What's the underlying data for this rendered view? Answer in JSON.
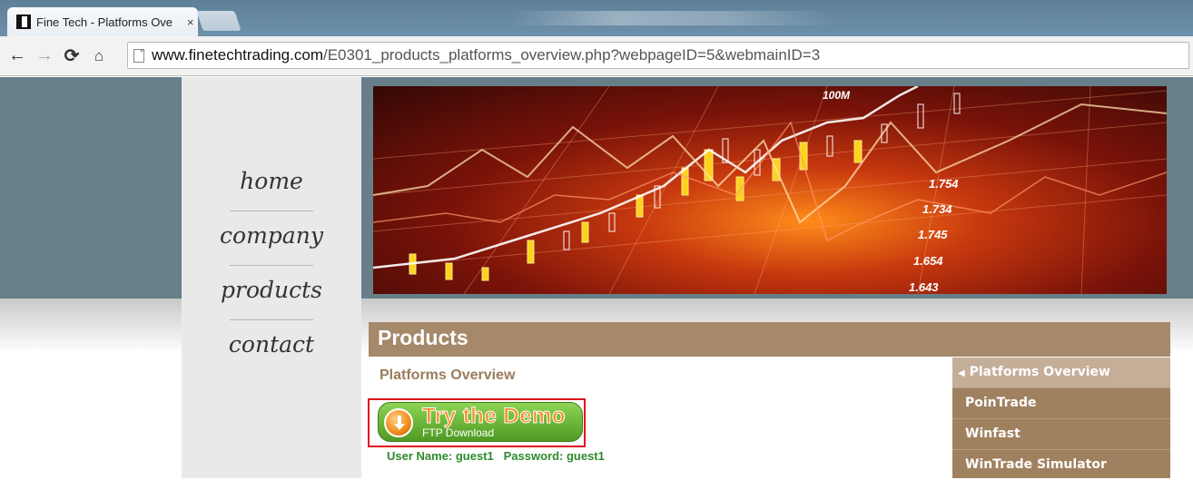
{
  "browser": {
    "tab_title": "Fine Tech - Platforms Ove",
    "tab_close": "×",
    "url_host": "www.finetechtrading.com",
    "url_path": "/E0301_products_platforms_overview.php?webpageID=5&webmainID=3",
    "icons": [
      "back-icon",
      "forward-icon",
      "reload-icon",
      "home-icon",
      "page-icon"
    ]
  },
  "nav": {
    "items": [
      {
        "label": "home"
      },
      {
        "label": "company"
      },
      {
        "label": "products"
      },
      {
        "label": "contact"
      }
    ]
  },
  "banner": {
    "labels": [
      "100M",
      "1.754",
      "1.734",
      "1.745",
      "1.654",
      "1.643"
    ]
  },
  "products": {
    "title": "Products",
    "section_title": "Platforms Overview",
    "demo": {
      "title": "Try the Demo",
      "subtitle": "FTP Download"
    },
    "credentials": "User Name: guest1   Password: guest1",
    "menu": [
      {
        "label": "Platforms Overview",
        "active": true
      },
      {
        "label": "PoinTrade",
        "active": false
      },
      {
        "label": "Winfast",
        "active": false
      },
      {
        "label": "WinTrade Simulator",
        "active": false
      }
    ]
  },
  "colors": {
    "header_band": "#667f88",
    "products_header": "#a5896a",
    "menu_bg": "#a0815f",
    "menu_active": "#c4ae98",
    "highlight_border": "#e0111a"
  }
}
